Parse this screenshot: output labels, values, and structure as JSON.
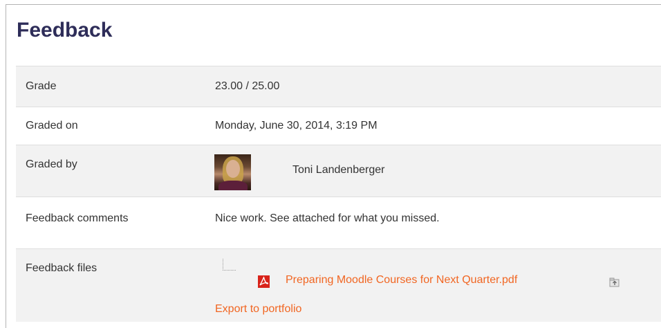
{
  "heading": "Feedback",
  "rows": {
    "grade": {
      "label": "Grade",
      "value": "23.00 / 25.00"
    },
    "graded_on": {
      "label": "Graded on",
      "value": "Monday, June 30, 2014, 3:19 PM"
    },
    "graded_by": {
      "label": "Graded by",
      "name": "Toni Landenberger",
      "avatar_icon": "user-photo"
    },
    "comments": {
      "label": "Feedback comments",
      "value": "Nice work.  See attached for what you missed."
    },
    "files": {
      "label": "Feedback files",
      "tree_icon": "tree-branch-icon",
      "file_icon": "pdf-file-icon",
      "file_name": "Preparing Moodle Courses for Next Quarter.pdf",
      "portfolio_icon": "export-portfolio-icon",
      "export_label": "Export to portfolio"
    }
  },
  "colors": {
    "heading": "#2e2d59",
    "link": "#f16622",
    "row_shade": "#f2f2f2",
    "text": "#333333"
  }
}
